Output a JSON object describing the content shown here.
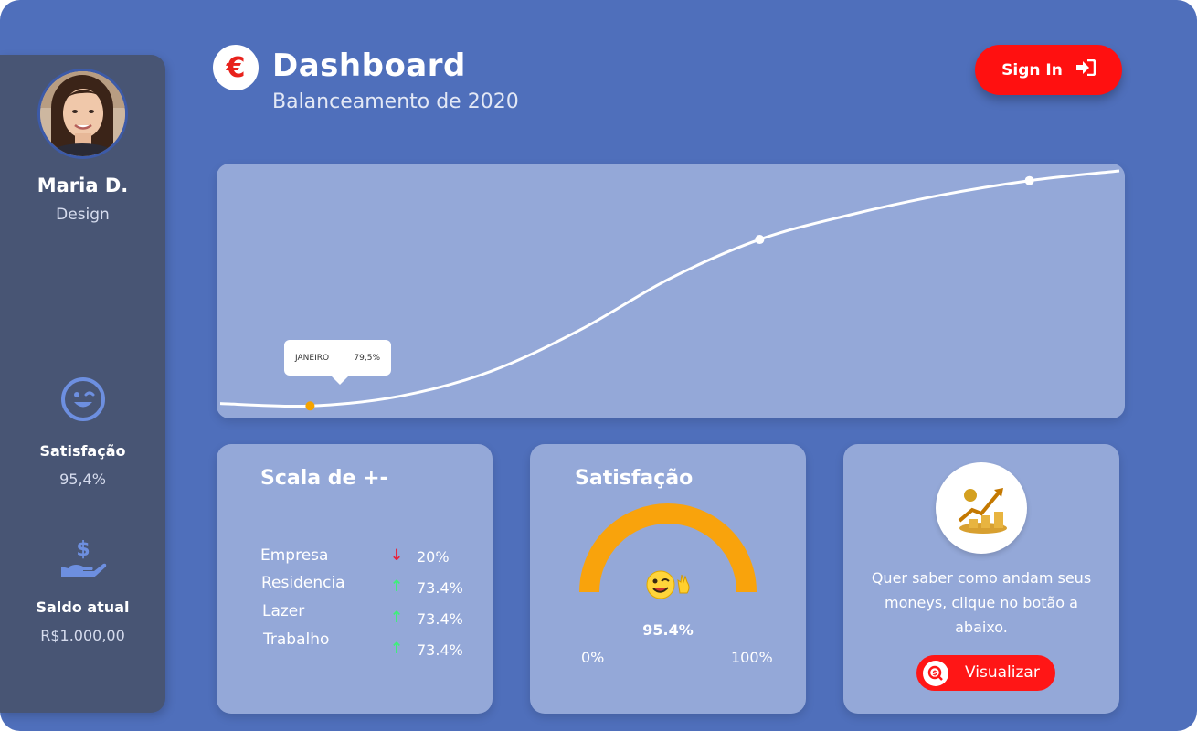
{
  "user": {
    "name": "Maria D.",
    "role": "Design"
  },
  "sidebar": {
    "satisfaction_label": "Satisfação",
    "satisfaction_value": "95,4%",
    "balance_label": "Saldo atual",
    "balance_value": "R$1.000,00"
  },
  "header": {
    "currency_symbol": "€",
    "title": "Dashboard",
    "subtitle": "Balanceamento de 2020",
    "signin_label": "Sign In"
  },
  "chart_data": {
    "type": "line",
    "title": "",
    "xlabel": "",
    "ylabel": "",
    "grid": false,
    "tooltip": {
      "label": "JANEIRO",
      "value": "79,5%"
    },
    "series": [
      {
        "values": [
          0.05,
          0.04,
          0.08,
          0.18,
          0.35,
          0.56,
          0.72,
          0.82,
          0.9,
          0.96,
          1.0
        ]
      }
    ],
    "markers": [
      {
        "index": 1,
        "color": "#f5a300"
      },
      {
        "index": 6,
        "color": "#ffffff"
      },
      {
        "index": 9,
        "color": "#ffffff"
      }
    ]
  },
  "scale": {
    "title": "Scala de +-",
    "items": [
      {
        "name": "Empresa",
        "direction": "down",
        "value": "20%"
      },
      {
        "name": "Residencia",
        "direction": "up",
        "value": "73.4%"
      },
      {
        "name": "Lazer",
        "direction": "up",
        "value": "73.4%"
      },
      {
        "name": "Trabalho",
        "direction": "up",
        "value": "73.4%"
      }
    ],
    "colors": {
      "up": "#3df07a",
      "down": "#e8243c"
    }
  },
  "satisfaction_card": {
    "title": "Satisfação",
    "value_label": "95.4%",
    "value": 0.954,
    "min_label": "0%",
    "max_label": "100%",
    "gauge_color": "#f9a30c",
    "icon": "winking-waving-emoji-icon"
  },
  "info_card": {
    "icon": "money-growth-chart-icon",
    "text": "Quer saber como andam seus moneys, clique no botão a abaixo.",
    "button_label": "Visualizar",
    "button_icon": "search-coin-icon"
  },
  "colors": {
    "background": "#4f6fbb",
    "sidebar": "#485574",
    "card": "#94a8d8",
    "accent": "#ff1010"
  }
}
